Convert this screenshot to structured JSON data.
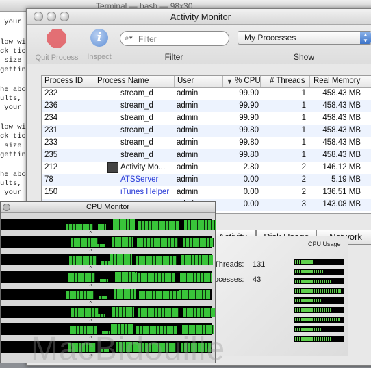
{
  "terminal": {
    "title": "Terminal — bash — 98x30",
    "lines": [
      " your s",
      "low wi",
      "ck tick",
      " size c",
      "getting",
      "he abov",
      "ults, p",
      " your s",
      "low wi",
      "ck tick",
      " size c",
      "getting",
      "he abov",
      "ults, p",
      " your s"
    ]
  },
  "activity_monitor": {
    "title": "Activity Monitor",
    "toolbar": {
      "quit_label": "Quit Process",
      "inspect_label": "Inspect",
      "filter_placeholder": "Filter",
      "filter_label": "Filter",
      "show_value": "My Processes",
      "show_label": "Show"
    },
    "columns": [
      "Process ID",
      "Process Name",
      "User",
      "% CPU",
      "# Threads",
      "Real Memory"
    ],
    "rows": [
      {
        "pid": "232",
        "name": "stream_d",
        "user": "admin",
        "cpu": "99.90",
        "threads": "1",
        "mem": "458.43 MB"
      },
      {
        "pid": "236",
        "name": "stream_d",
        "user": "admin",
        "cpu": "99.90",
        "threads": "1",
        "mem": "458.43 MB"
      },
      {
        "pid": "234",
        "name": "stream_d",
        "user": "admin",
        "cpu": "99.90",
        "threads": "1",
        "mem": "458.43 MB"
      },
      {
        "pid": "231",
        "name": "stream_d",
        "user": "admin",
        "cpu": "99.80",
        "threads": "1",
        "mem": "458.43 MB"
      },
      {
        "pid": "233",
        "name": "stream_d",
        "user": "admin",
        "cpu": "99.80",
        "threads": "1",
        "mem": "458.43 MB"
      },
      {
        "pid": "235",
        "name": "stream_d",
        "user": "admin",
        "cpu": "99.80",
        "threads": "1",
        "mem": "458.43 MB"
      },
      {
        "pid": "212",
        "name": "Activity Mo...",
        "user": "admin",
        "cpu": "2.80",
        "threads": "2",
        "mem": "146.12 MB"
      },
      {
        "pid": "78",
        "name": "ATSServer",
        "user": "admin",
        "cpu": "0.00",
        "threads": "2",
        "mem": "5.19 MB"
      },
      {
        "pid": "150",
        "name": "iTunes Helper",
        "user": "admin",
        "cpu": "0.00",
        "threads": "2",
        "mem": "136.51 MB"
      },
      {
        "pid": "",
        "name": "",
        "user": "admin",
        "cpu": "0.00",
        "threads": "3",
        "mem": "143.08 MB"
      }
    ],
    "tabs": [
      "Activity",
      "Disk Usage",
      "Network"
    ],
    "stats": {
      "threads_label": "Threads:",
      "threads_value": "131",
      "processes_label": "ocesses:",
      "processes_value": "43"
    },
    "cpu_usage_label": "CPU Usage"
  },
  "cpu_monitor": {
    "title": "CPU Monitor",
    "core_count": 8
  },
  "watermark": "MacBidouille",
  "colors": {
    "accent_blue": "#3d74c9",
    "cpu_green": "#39c53a",
    "link_blue": "#2a3cd8"
  }
}
